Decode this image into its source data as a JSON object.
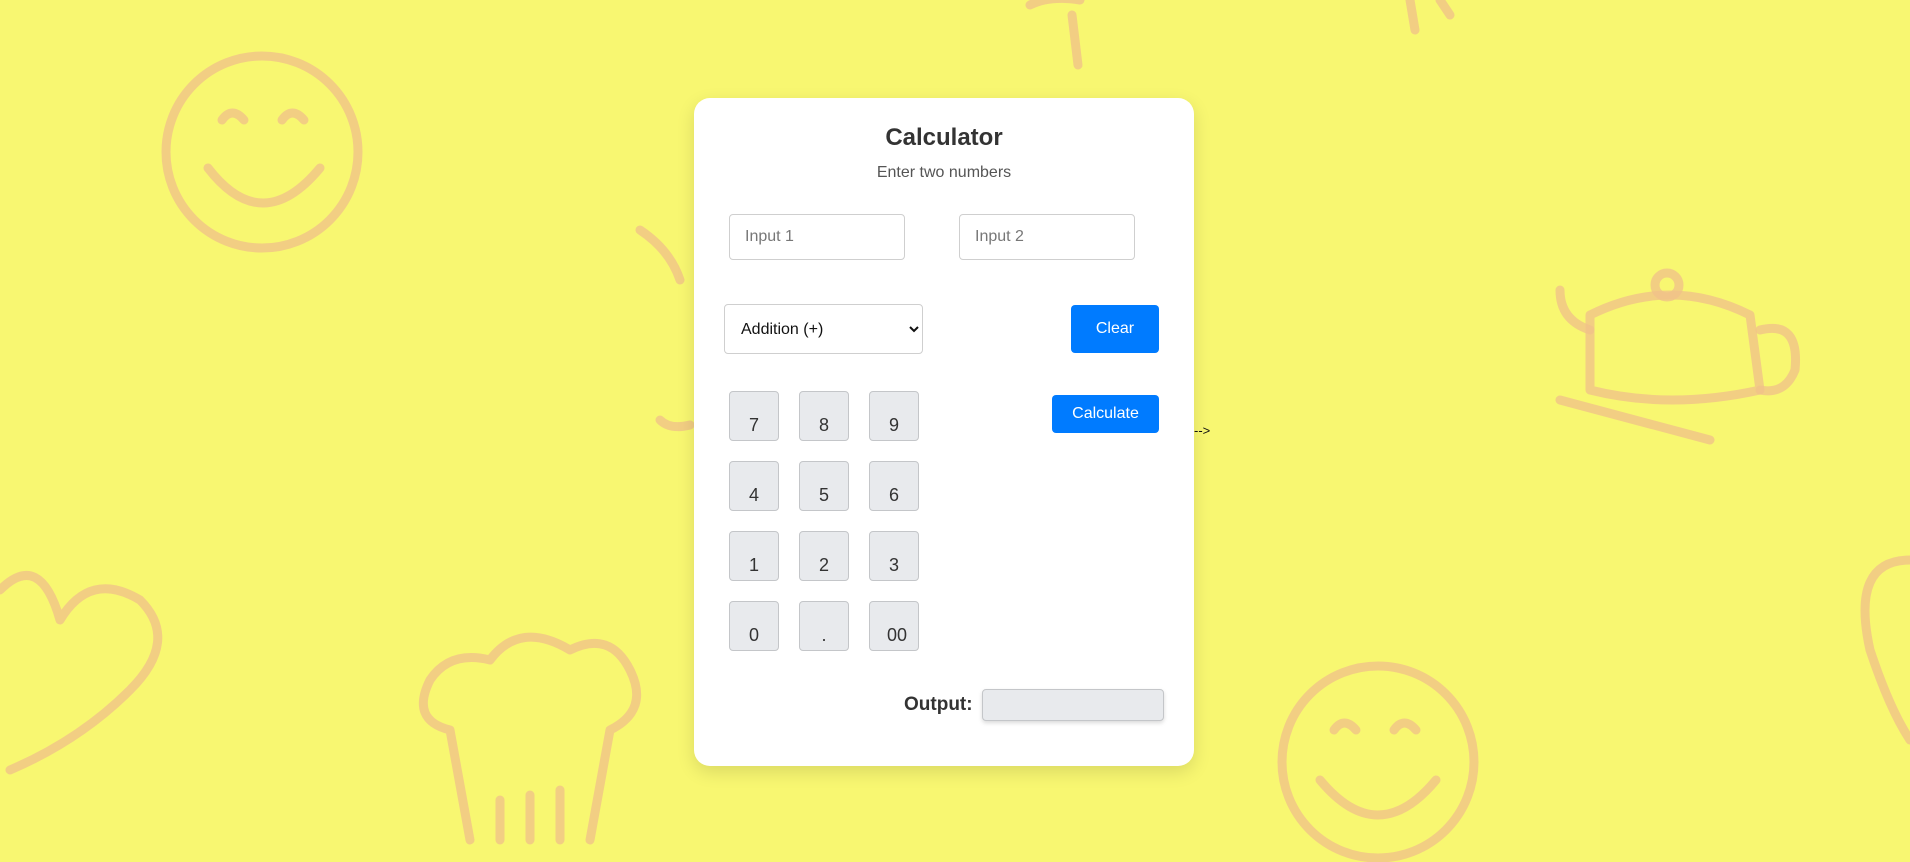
{
  "calculator": {
    "title": "Calculator",
    "subtitle": "Enter two numbers",
    "input1_placeholder": "Input 1",
    "input2_placeholder": "Input 2",
    "operation_selected": "Addition (+)",
    "clear_label": "Clear",
    "calculate_label": "Calculate",
    "keys": [
      "7",
      "8",
      "9",
      "4",
      "5",
      "6",
      "1",
      "2",
      "3",
      "0",
      ".",
      "00"
    ],
    "output_label": "Output:",
    "output_value": ""
  },
  "stray_text": "-->",
  "colors": {
    "background": "#f8f771",
    "card": "#ffffff",
    "accent": "#007bff",
    "key": "#e8eaed",
    "doodles": "#f0c08a"
  },
  "decorations": [
    "smiley-icon",
    "heart-icon",
    "chef-hat-icon",
    "teapot-icon",
    "fork-icon"
  ]
}
